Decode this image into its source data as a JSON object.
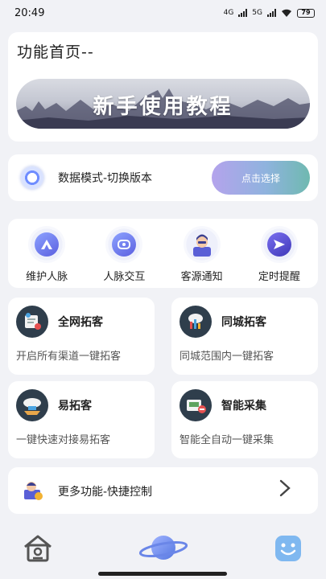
{
  "status_bar": {
    "time": "20:49",
    "battery": "79",
    "net_4g": "4G",
    "net_5g": "5G"
  },
  "header": {
    "title": "功能首页--",
    "banner_text": "新手使用教程"
  },
  "mode": {
    "label": "数据模式-切换版本",
    "button_label": "点击选择"
  },
  "quick_actions": [
    {
      "label": "维护人脉",
      "icon": "triangle-icon"
    },
    {
      "label": "人脉交互",
      "icon": "chat-icon"
    },
    {
      "label": "客源通知",
      "icon": "agent-icon"
    },
    {
      "label": "定时提醒",
      "icon": "send-icon"
    }
  ],
  "features": [
    {
      "title": "全网拓客",
      "desc": "开启所有渠道一键拓客",
      "icon": "network-icon"
    },
    {
      "title": "同城拓客",
      "desc": "同城范围内一键拓客",
      "icon": "city-chart-icon"
    },
    {
      "title": "易拓客",
      "desc": "一键快速对接易拓客",
      "icon": "cloud-icon"
    },
    {
      "title": "智能采集",
      "desc": "智能全自动一键采集",
      "icon": "collect-icon"
    }
  ],
  "more": {
    "label": "更多功能-快捷控制"
  },
  "nav": {
    "active": "planet"
  },
  "colors": {
    "accent_start": "#b4a3ec",
    "accent_end": "#6fb9b0",
    "planet": "#6a86e8",
    "face": "#7fb8f0"
  }
}
